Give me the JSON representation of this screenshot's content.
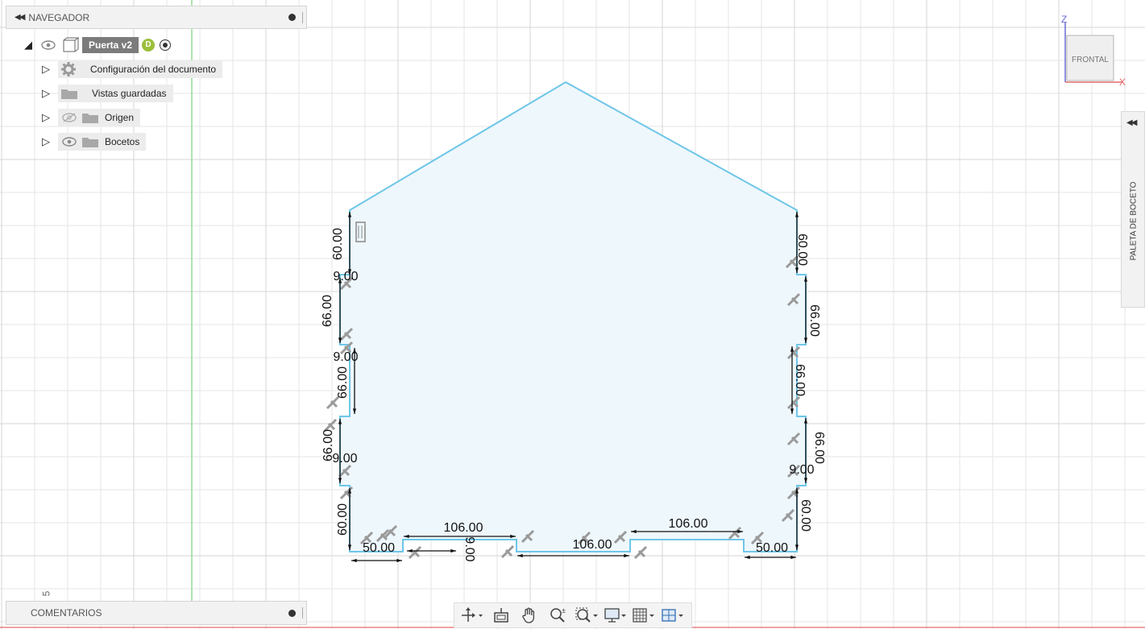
{
  "navigator": {
    "title": "NAVEGADOR",
    "root": {
      "label": "Puerta v2",
      "badge": "D"
    },
    "items": [
      {
        "label": "Configuración del documento",
        "icon": "gear-icon"
      },
      {
        "label": "Vistas guardadas",
        "icon": "folder-icon"
      },
      {
        "label": "Origen",
        "icon": "folder-icon",
        "hidden_eye": true
      },
      {
        "label": "Bocetos",
        "icon": "folder-icon",
        "hidden_eye": false
      }
    ]
  },
  "comments": {
    "title": "COMENTARIOS"
  },
  "palette": {
    "title": "PALETA DE BOCETO"
  },
  "viewcube": {
    "face_label": "FRONTAL",
    "axis_z": "Z",
    "axis_x": "X"
  },
  "corner_number": "5",
  "dimensions": {
    "left": [
      "60.00",
      "9.00",
      "66.00",
      "9.00",
      "66.00",
      "66.00",
      "9.00",
      "60.00"
    ],
    "right": [
      "60.00",
      "66.00",
      "66.00",
      "66.00",
      "9.00",
      "60.00"
    ],
    "bottom": [
      "50.00",
      "106.00",
      "9.00",
      "106.00",
      "106.00",
      "50.00"
    ]
  },
  "colors": {
    "sketch_line": "#6ec6e8",
    "sketch_fill": "#eef7fc",
    "grid_line": "#e3e3e3",
    "axis_green": "#7ad37a",
    "axis_red": "#e46b6b",
    "dimension": "#111111"
  }
}
